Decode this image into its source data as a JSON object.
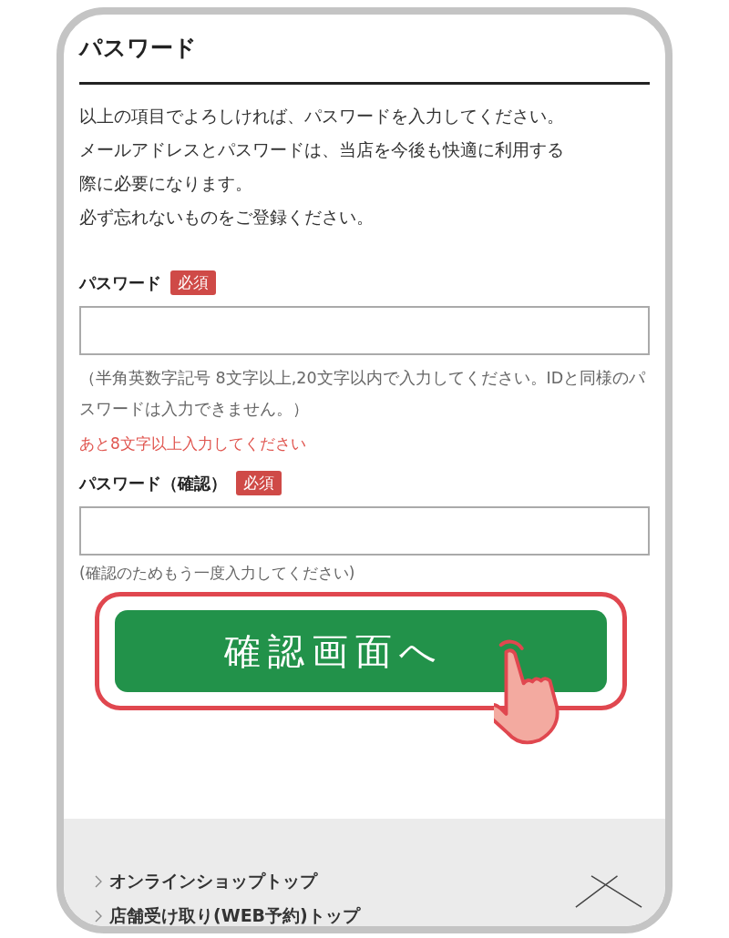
{
  "section": {
    "title": "パスワード"
  },
  "intro": [
    "以上の項目でよろしければ、パスワードを入力してください。",
    "メールアドレスとパスワードは、当店を今後も快適に利用する",
    "際に必要になります。",
    "必ず忘れないものをご登録ください。"
  ],
  "fields": [
    {
      "label": "パスワード",
      "badge": "必須",
      "hint": "（半角英数字記号 8文字以上,20文字以内で入力してください。IDと同様のパスワードは入力できません。）",
      "error": "あと8文字以上入力してください"
    },
    {
      "label": "パスワード（確認）",
      "badge": "必須",
      "hint": "(確認のためもう一度入力してください)"
    }
  ],
  "submit": {
    "label": "確認画面へ",
    "highlighted": true
  },
  "footer_links": [
    {
      "label": "オンラインショップトップ"
    },
    {
      "label": "店舗受け取り(WEB予約)トップ"
    }
  ]
}
